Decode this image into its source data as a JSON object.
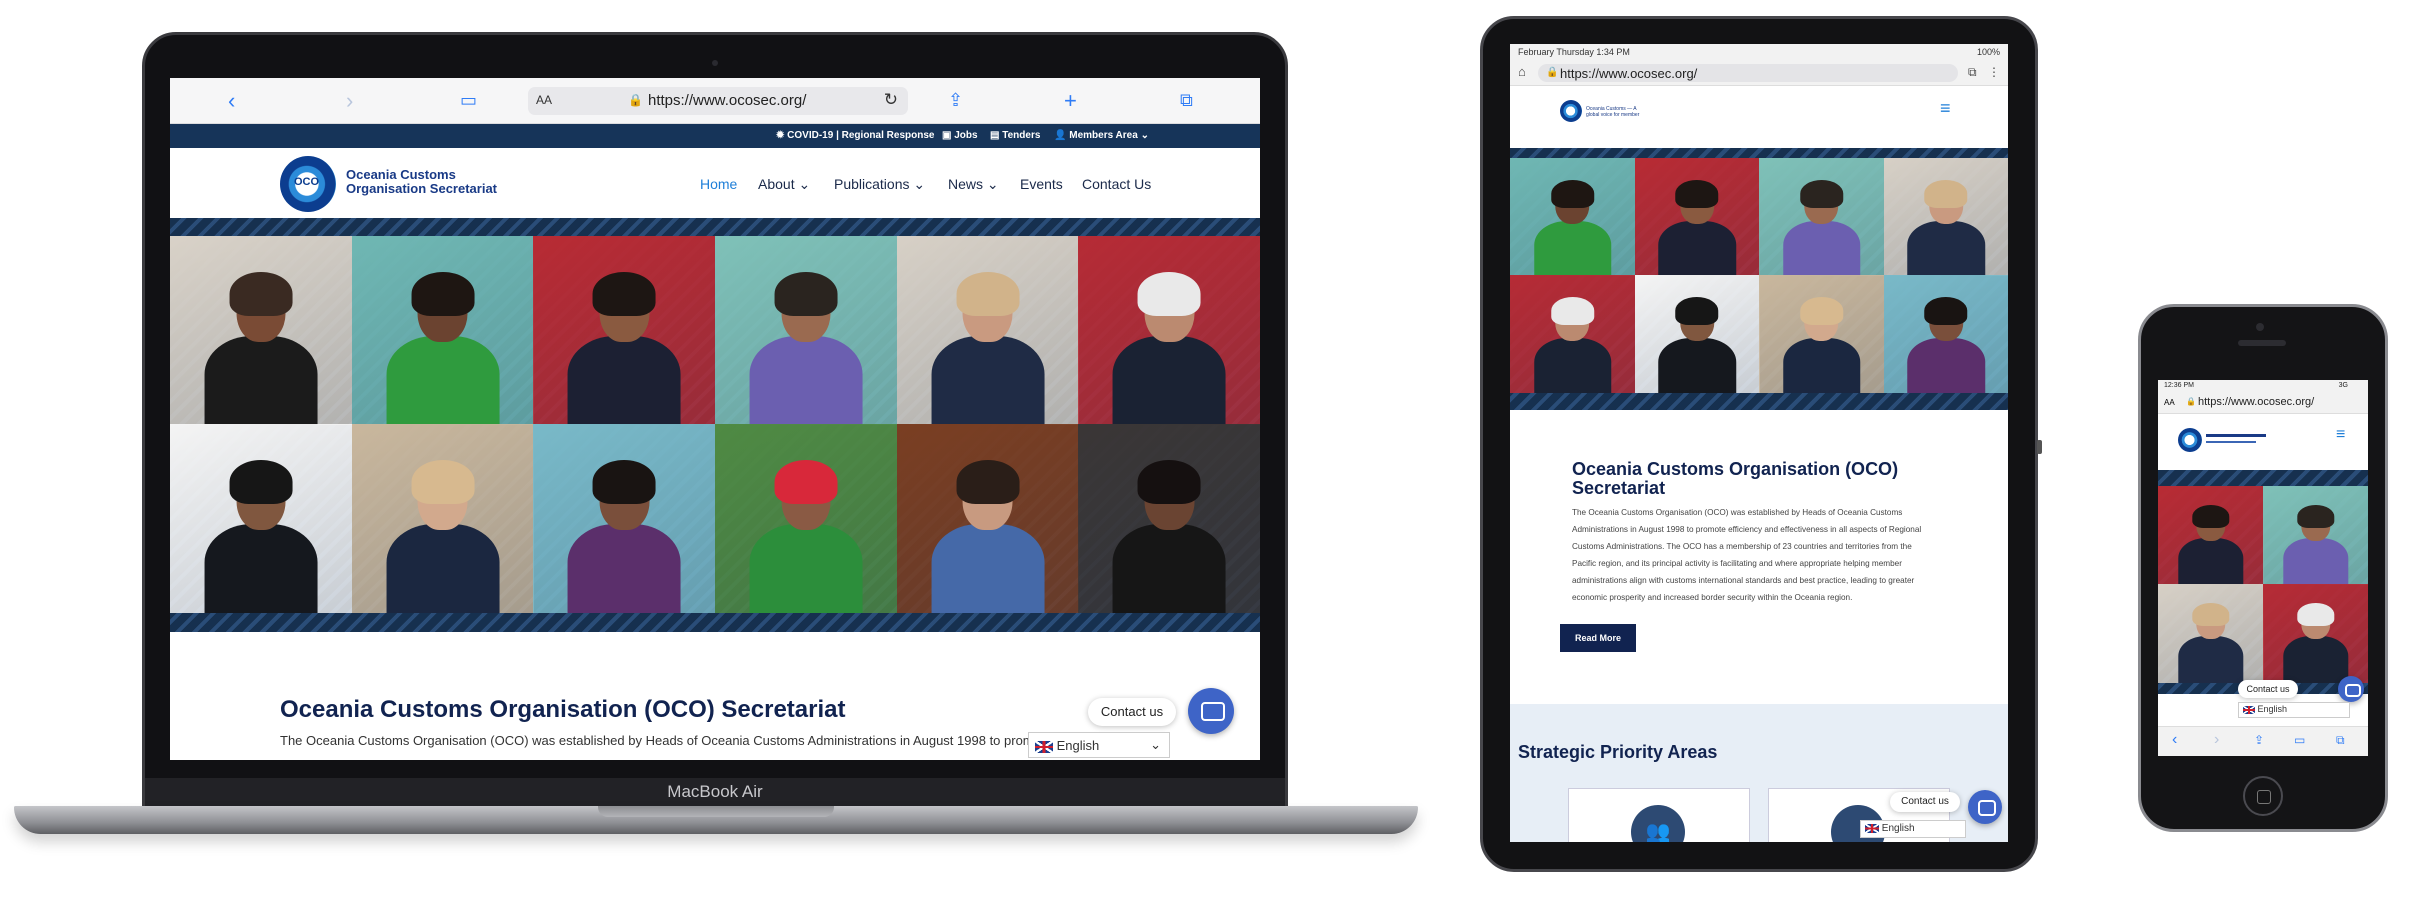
{
  "laptop": {
    "brand_label": "MacBook Air",
    "browser": {
      "text_size_label": "AA",
      "url": "https://www.ocosec.org/"
    },
    "topbar": {
      "covid": "COVID-19 | Regional Response",
      "jobs": "Jobs",
      "tenders": "Tenders",
      "members": "Members Area"
    },
    "logo": {
      "line1": "Oceania Customs",
      "line2": "Organisation Secretariat",
      "mark": "OCO"
    },
    "nav": [
      "Home",
      "About",
      "Publications",
      "News",
      "Events",
      "Contact Us"
    ],
    "section_title": "Oceania Customs Organisation (OCO) Secretariat",
    "intro_text": "The Oceania Customs Organisation (OCO) was established by Heads of Oceania Customs Administrations in August 1998 to promote effici",
    "contact_label": "Contact us",
    "language": "English"
  },
  "tablet": {
    "status": {
      "time": "February Thursday 1:34 PM",
      "battery": "100%"
    },
    "url": "https://www.ocosec.org/",
    "logo_tagline": "Oceania Customs — A global voice for member",
    "section_title_line1": "Oceania Customs Organisation (OCO)",
    "section_title_line2": "Secretariat",
    "body_lines": [
      "The Oceania Customs Organisation (OCO) was established by Heads of Oceania Customs",
      "Administrations in August 1998 to promote efficiency and effectiveness in all aspects of Regional",
      "Customs Administrations. The OCO has a membership of 23 countries and territories from the",
      "Pacific region, and its principal activity is facilitating and where appropriate helping member",
      "administrations align with customs international standards and best practice, leading to greater",
      "economic prosperity and increased border security within the Oceania region."
    ],
    "read_more": "Read More",
    "priority_title": "Strategic Priority Areas",
    "contact_label": "Contact us",
    "language": "English"
  },
  "phone": {
    "status": {
      "time": "12:36 PM",
      "signal": "3G"
    },
    "text_size_label": "AA",
    "url": "https://www.ocosec.org/",
    "contact_label": "Contact us",
    "language": "English"
  },
  "colors": {
    "navy": "#163459",
    "link_blue": "#1f7fd8",
    "title_navy": "#112350",
    "chat_blue": "#3e64c7",
    "safari_blue": "#2f7cf6"
  },
  "icons": [
    "back-icon",
    "forward-icon",
    "bookmarks-icon",
    "lock-icon",
    "reload-icon",
    "share-icon",
    "new-tab-icon",
    "tabs-icon",
    "hamburger-menu-icon",
    "chat-icon",
    "chevron-down-icon",
    "home-icon"
  ]
}
